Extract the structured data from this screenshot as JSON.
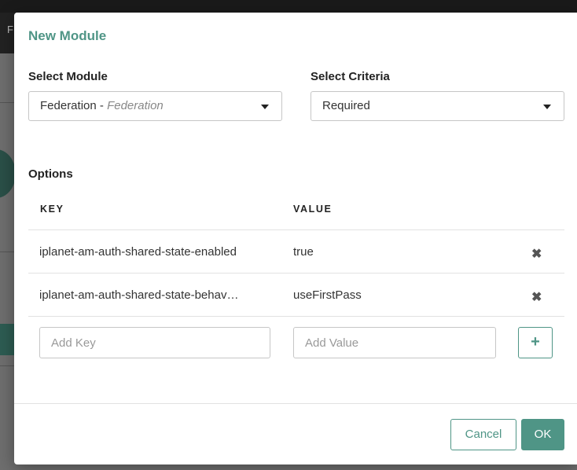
{
  "background": {
    "partial_letter": "F"
  },
  "modal": {
    "title": "New Module",
    "select_module": {
      "label": "Select Module",
      "value": "Federation",
      "separator": " - ",
      "value_hint": "Federation"
    },
    "select_criteria": {
      "label": "Select Criteria",
      "value": "Required"
    },
    "options": {
      "label": "Options",
      "columns": [
        "KEY",
        "VALUE"
      ],
      "rows": [
        {
          "key": "iplanet-am-auth-shared-state-enabled",
          "value": "true"
        },
        {
          "key": "iplanet-am-auth-shared-state-behav…",
          "value": "useFirstPass"
        }
      ],
      "add_key_placeholder": "Add Key",
      "add_value_placeholder": "Add Value",
      "add_button_label": "+"
    },
    "delete_icon": "✖",
    "footer": {
      "cancel_label": "Cancel",
      "ok_label": "OK"
    }
  },
  "colors": {
    "accent": "#4f9586",
    "overlay": "#6e6e6e"
  }
}
